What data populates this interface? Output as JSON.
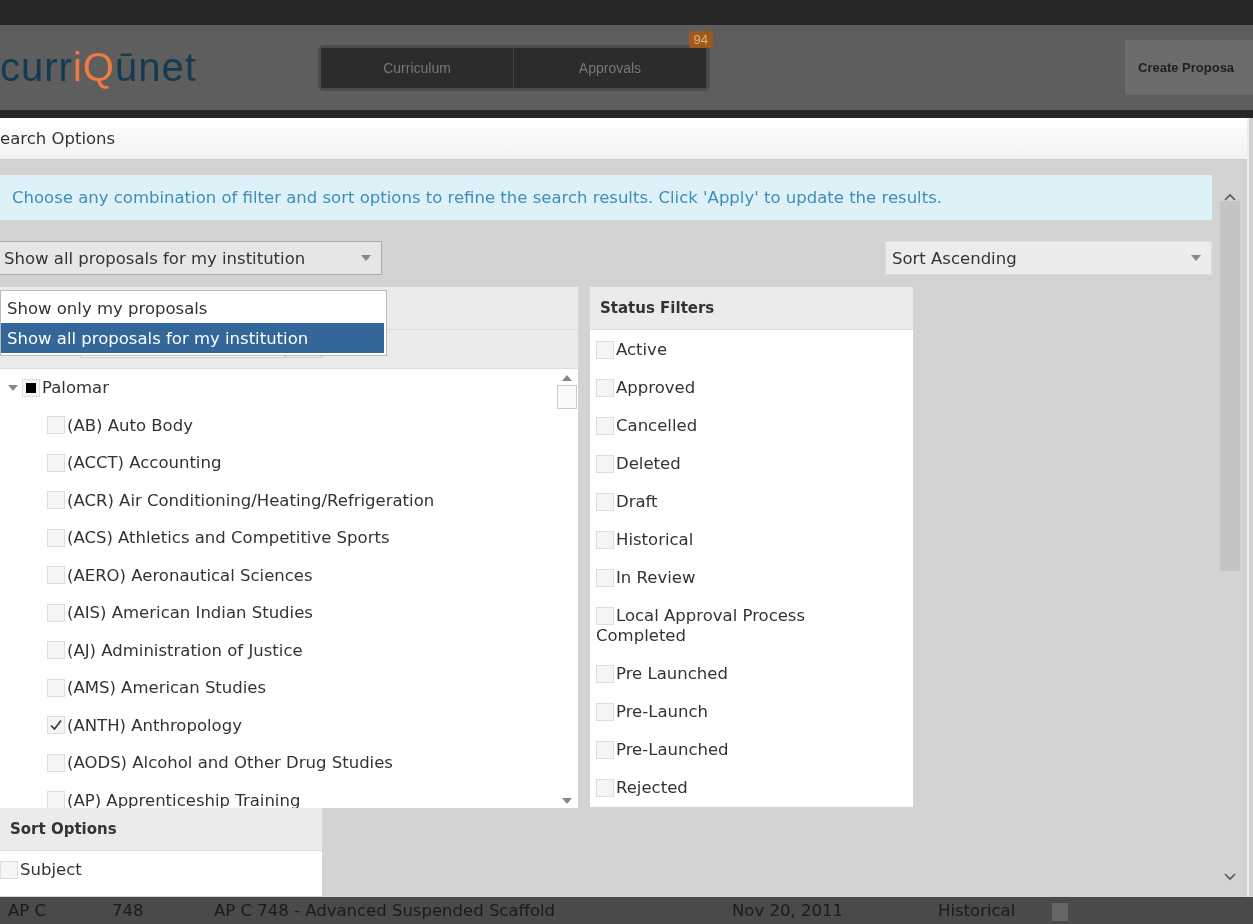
{
  "header": {
    "logo": [
      {
        "text": "curr",
        "accent": false
      },
      {
        "text": "iQ",
        "accent": true
      },
      {
        "text": "ūnet",
        "accent": false
      }
    ],
    "nav": [
      {
        "label": "Curriculum"
      },
      {
        "label": "Approvals",
        "badge": "94"
      }
    ],
    "create_button": "Create Proposa"
  },
  "dialog": {
    "title": "earch Options",
    "info": "Choose any combination of filter and sort options to refine the search results. Click 'Apply' to update the results.",
    "scope_dropdown": {
      "value": "Show all proposals for my institution",
      "expanded": true,
      "options": [
        {
          "label": "Show only my proposals",
          "selected": false
        },
        {
          "label": "Show all proposals for my institution",
          "selected": true
        }
      ]
    },
    "sort_direction": {
      "value": "Sort Ascending"
    },
    "subjects": {
      "tree": [
        {
          "label": "Palomar",
          "expanded": true,
          "checked": false,
          "indeterminate": true,
          "children": [
            {
              "label": "(AB) Auto Body",
              "checked": false
            },
            {
              "label": "(ACCT) Accounting",
              "checked": false
            },
            {
              "label": "(ACR) Air Conditioning/Heating/Refrigeration",
              "checked": false
            },
            {
              "label": "(ACS) Athletics and Competitive Sports",
              "checked": false
            },
            {
              "label": "(AERO) Aeronautical Sciences",
              "checked": false
            },
            {
              "label": "(AIS) American Indian Studies",
              "checked": false
            },
            {
              "label": "(AJ) Administration of Justice",
              "checked": false
            },
            {
              "label": "(AMS) American Studies",
              "checked": false
            },
            {
              "label": "(ANTH) Anthropology",
              "checked": true
            },
            {
              "label": "(AODS) Alcohol and Other Drug Studies",
              "checked": false
            },
            {
              "label": "(AP) Apprenticeship Training",
              "checked": false
            }
          ]
        }
      ]
    },
    "status_filters": {
      "title": "Status Filters",
      "items": [
        {
          "label": "Active",
          "checked": false
        },
        {
          "label": "Approved",
          "checked": false
        },
        {
          "label": "Cancelled",
          "checked": false
        },
        {
          "label": "Deleted",
          "checked": false
        },
        {
          "label": "Draft",
          "checked": false
        },
        {
          "label": "Historical",
          "checked": false
        },
        {
          "label": "In Review",
          "checked": false
        },
        {
          "label": "Local Approval Process Completed",
          "checked": false
        },
        {
          "label": "Pre Launched",
          "checked": false
        },
        {
          "label": "Pre-Launch",
          "checked": false
        },
        {
          "label": "Pre-Launched",
          "checked": false
        },
        {
          "label": "Rejected",
          "checked": false
        }
      ]
    },
    "sort_options": {
      "title": "Sort Options",
      "items": [
        {
          "label": "Subject",
          "checked": false
        }
      ]
    }
  },
  "results_row": [
    "AP C",
    "748",
    "AP C 748 - Advanced Suspended Scaffold",
    "Nov 20, 2011",
    "Historical"
  ]
}
